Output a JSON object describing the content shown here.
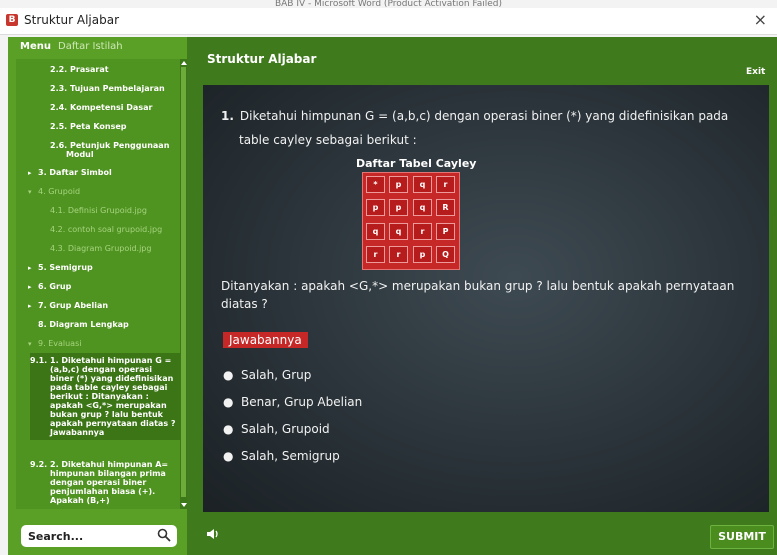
{
  "window": {
    "word_title": "BAB IV - Microsoft Word (Product Activation Failed)",
    "title": "Struktur Aljabar",
    "close_label": "×"
  },
  "sidebar": {
    "tabs": [
      "Menu",
      "Daftar Istilah"
    ],
    "items": [
      {
        "num": "2.2.",
        "label": "Prasarat"
      },
      {
        "num": "2.3.",
        "label": "Tujuan Pembelajaran"
      },
      {
        "num": "2.4.",
        "label": "Kompetensi Dasar"
      },
      {
        "num": "2.5.",
        "label": "Peta Konsep"
      },
      {
        "num": "2.6.",
        "label": "Petunjuk Penggunaan"
      },
      {
        "num": "",
        "label": "Modul"
      },
      {
        "num": "3.",
        "label": "Daftar Simbol"
      },
      {
        "num": "4.",
        "label": "Grupoid"
      },
      {
        "num": "4.1.",
        "label": "Definisi Grupoid.jpg"
      },
      {
        "num": "4.2.",
        "label": "contoh soal grupoid.jpg"
      },
      {
        "num": "4.3.",
        "label": "Diagram Grupoid.jpg"
      },
      {
        "num": "5.",
        "label": "Semigrup"
      },
      {
        "num": "6.",
        "label": "Grup"
      },
      {
        "num": "7.",
        "label": "Grup Abelian"
      },
      {
        "num": "8.",
        "label": "Diagram Lengkap"
      },
      {
        "num": "9.",
        "label": "Evaluasi"
      },
      {
        "num": "9.1.",
        "label": "1. Diketahui himpunan G = (a,b,c) dengan operasi biner (*) yang didefinisikan pada table cayley sebagai berikut : Ditanyakan : apakah <G,*> merupakan bukan grup ? lalu bentuk apakah pernyataan diatas ? Jawabannya"
      },
      {
        "num": "9.2.",
        "label": "2. Diketahui himpunan A= himpunan bilangan prima dengan operasi biner penjumlahan biasa (+). Apakah (B,+)"
      }
    ],
    "search_label": "Search..."
  },
  "main": {
    "title": "Struktur Aljabar",
    "exit_label": "Exit",
    "question_number": "1.",
    "question_line1": "Diketahui himpunan G = (a,b,c) dengan operasi biner (*) yang didefinisikan pada",
    "question_line2": "table cayley sebagai berikut :",
    "table_title": "Daftar Tabel Cayley",
    "cayley": [
      [
        "*",
        "p",
        "q",
        "r"
      ],
      [
        "p",
        "p",
        "q",
        "R"
      ],
      [
        "q",
        "q",
        "r",
        "P"
      ],
      [
        "r",
        "r",
        "p",
        "Q"
      ]
    ],
    "question_ask": "Ditanyakan : apakah <G,*> merupakan bukan grup ? lalu bentuk apakah pernyataan diatas ?",
    "answer_tag": "Jawabannya",
    "options": [
      "Salah, Grup",
      "Benar, Grup Abelian",
      "Salah, Grupoid",
      "Salah, Semigrup"
    ],
    "submit_label": "SUBMIT"
  },
  "colors": {
    "frame_green": "#3f7a1c",
    "sidebar_green": "#5aa026",
    "accent_red": "#c62828",
    "chalkboard": "#2a3339"
  }
}
